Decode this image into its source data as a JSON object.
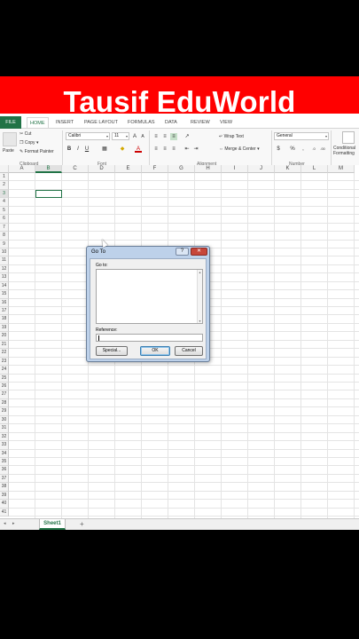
{
  "banner": {
    "title": "Tausif EduWorld",
    "bg_color": "#ff0000"
  },
  "ribbon_tabs": [
    "FILE",
    "HOME",
    "INSERT",
    "PAGE LAYOUT",
    "FORMULAS",
    "DATA",
    "REVIEW",
    "VIEW"
  ],
  "clipboard": {
    "paste": "Paste",
    "cut": "Cut",
    "copy": "Copy",
    "format_painter": "Format Painter",
    "group_label": "Clipboard"
  },
  "font": {
    "name": "Calibri",
    "size": "11",
    "bold": "B",
    "italic": "I",
    "underline": "U",
    "grow": "A",
    "shrink": "A",
    "color_a": "A",
    "group_label": "Font"
  },
  "alignment": {
    "wrap_text": "Wrap Text",
    "merge_center": "Merge & Center",
    "group_label": "Alignment"
  },
  "number": {
    "format": "General",
    "currency": "$",
    "percent": "%",
    "comma": ",",
    "group_label": "Number"
  },
  "styles": {
    "conditional_formatting": "Conditional Formatting"
  },
  "grid": {
    "columns": [
      "A",
      "B",
      "C",
      "D",
      "E",
      "F",
      "G",
      "H",
      "I",
      "J",
      "K",
      "L",
      "M"
    ],
    "selected_column": "B",
    "rows": [
      "1",
      "2",
      "3",
      "4",
      "5",
      "6",
      "7",
      "8",
      "9",
      "10",
      "11",
      "12",
      "13",
      "14",
      "15",
      "16",
      "17",
      "18",
      "19",
      "20",
      "21",
      "22",
      "23",
      "24",
      "25",
      "26",
      "27",
      "28",
      "29",
      "30",
      "31",
      "32",
      "33",
      "34",
      "35",
      "36",
      "37",
      "38",
      "39",
      "40",
      "41"
    ],
    "selected_row": "3"
  },
  "sheets": {
    "active": "Sheet1",
    "add": "+",
    "nav_prev": "◂",
    "nav_next": "▸"
  },
  "goto_dialog": {
    "title": "Go To",
    "help": "?",
    "close": "✕",
    "goto_label": "Go to:",
    "reference_label": "Reference:",
    "reference_value": "",
    "special_button": "Special...",
    "ok_button": "OK",
    "cancel_button": "Cancel"
  },
  "colors": {
    "excel_green": "#217346",
    "dialog_frame": "#bdd1ea"
  }
}
